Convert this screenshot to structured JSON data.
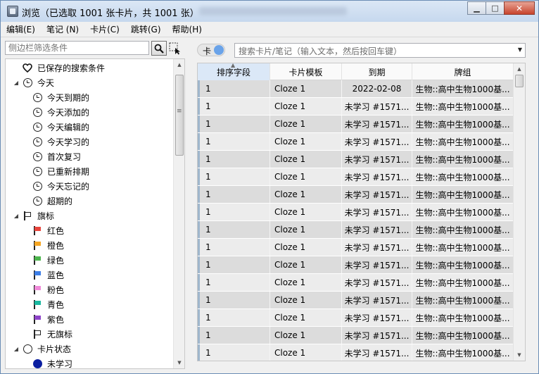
{
  "window": {
    "title": "浏览（已选取 1001 张卡片，共 1001 张）",
    "controls": {
      "minimize": "▁",
      "maximize": "□",
      "close": "✕"
    }
  },
  "menu": [
    "编辑(E)",
    "笔记 (N)",
    "卡片(C)",
    "跳转(G)",
    "帮助(H)"
  ],
  "sidebar": {
    "filter_placeholder": "侧边栏筛选条件",
    "items": [
      {
        "label": "已保存的搜索条件",
        "icon": "heart-icon",
        "level": 0,
        "arrow": ""
      },
      {
        "label": "今天",
        "icon": "clock-icon",
        "level": 0,
        "arrow": "◢"
      },
      {
        "label": "今天到期的",
        "icon": "clock-icon",
        "level": 1,
        "arrow": ""
      },
      {
        "label": "今天添加的",
        "icon": "clock-icon",
        "level": 1,
        "arrow": ""
      },
      {
        "label": "今天编辑的",
        "icon": "clock-icon",
        "level": 1,
        "arrow": ""
      },
      {
        "label": "今天学习的",
        "icon": "clock-icon",
        "level": 1,
        "arrow": ""
      },
      {
        "label": "首次复习",
        "icon": "clock-icon",
        "level": 1,
        "arrow": ""
      },
      {
        "label": "已重新排期",
        "icon": "clock-icon",
        "level": 1,
        "arrow": ""
      },
      {
        "label": "今天忘记的",
        "icon": "clock-icon",
        "level": 1,
        "arrow": ""
      },
      {
        "label": "超期的",
        "icon": "clock-icon",
        "level": 1,
        "arrow": ""
      },
      {
        "label": "旗标",
        "icon": "flag-icon",
        "level": 0,
        "arrow": "◢"
      },
      {
        "label": "红色",
        "icon": "flag-icon",
        "level": 1,
        "arrow": "",
        "color": "#e8453c"
      },
      {
        "label": "橙色",
        "icon": "flag-icon",
        "level": 1,
        "arrow": "",
        "color": "#f5a623"
      },
      {
        "label": "绿色",
        "icon": "flag-icon",
        "level": 1,
        "arrow": "",
        "color": "#4cb54c"
      },
      {
        "label": "蓝色",
        "icon": "flag-icon",
        "level": 1,
        "arrow": "",
        "color": "#3d7ee6"
      },
      {
        "label": "粉色",
        "icon": "flag-icon",
        "level": 1,
        "arrow": "",
        "color": "#f08ad9"
      },
      {
        "label": "青色",
        "icon": "flag-icon",
        "level": 1,
        "arrow": "",
        "color": "#1ab8a0"
      },
      {
        "label": "紫色",
        "icon": "flag-icon",
        "level": 1,
        "arrow": "",
        "color": "#8e44c9"
      },
      {
        "label": "无旗标",
        "icon": "flag-icon",
        "level": 1,
        "arrow": "",
        "color": "transparent"
      },
      {
        "label": "卡片状态",
        "icon": "circle-icon",
        "level": 0,
        "arrow": "◢"
      },
      {
        "label": "未学习",
        "icon": "filled-circle-icon",
        "level": 1,
        "arrow": "",
        "color": "#0a1ea0"
      }
    ]
  },
  "toolbar": {
    "toggle_label": "卡",
    "search_placeholder": "搜索卡片/笔记（输入文本，然后按回车键）"
  },
  "table": {
    "columns": [
      "排序字段",
      "卡片模板",
      "到期",
      "牌组"
    ],
    "rows": [
      [
        "1",
        "Cloze 1",
        "2022-02-08",
        "生物::高中生物1000基..."
      ],
      [
        "1",
        "Cloze 1",
        "未学习 #1571...",
        "生物::高中生物1000基..."
      ],
      [
        "1",
        "Cloze 1",
        "未学习 #1571...",
        "生物::高中生物1000基..."
      ],
      [
        "1",
        "Cloze 1",
        "未学习 #1571...",
        "生物::高中生物1000基..."
      ],
      [
        "1",
        "Cloze 1",
        "未学习 #1571...",
        "生物::高中生物1000基..."
      ],
      [
        "1",
        "Cloze 1",
        "未学习 #1571...",
        "生物::高中生物1000基..."
      ],
      [
        "1",
        "Cloze 1",
        "未学习 #1571...",
        "生物::高中生物1000基..."
      ],
      [
        "1",
        "Cloze 1",
        "未学习 #1571...",
        "生物::高中生物1000基..."
      ],
      [
        "1",
        "Cloze 1",
        "未学习 #1571...",
        "生物::高中生物1000基..."
      ],
      [
        "1",
        "Cloze 1",
        "未学习 #1571...",
        "生物::高中生物1000基..."
      ],
      [
        "1",
        "Cloze 1",
        "未学习 #1571...",
        "生物::高中生物1000基..."
      ],
      [
        "1",
        "Cloze 1",
        "未学习 #1571...",
        "生物::高中生物1000基..."
      ],
      [
        "1",
        "Cloze 1",
        "未学习 #1571...",
        "生物::高中生物1000基..."
      ],
      [
        "1",
        "Cloze 1",
        "未学习 #1571...",
        "生物::高中生物1000基..."
      ],
      [
        "1",
        "Cloze 1",
        "未学习 #1571...",
        "生物::高中生物1000基..."
      ],
      [
        "1",
        "Cloze 1",
        "未学习 #1571...",
        "生物::高中生物1000基..."
      ]
    ]
  }
}
